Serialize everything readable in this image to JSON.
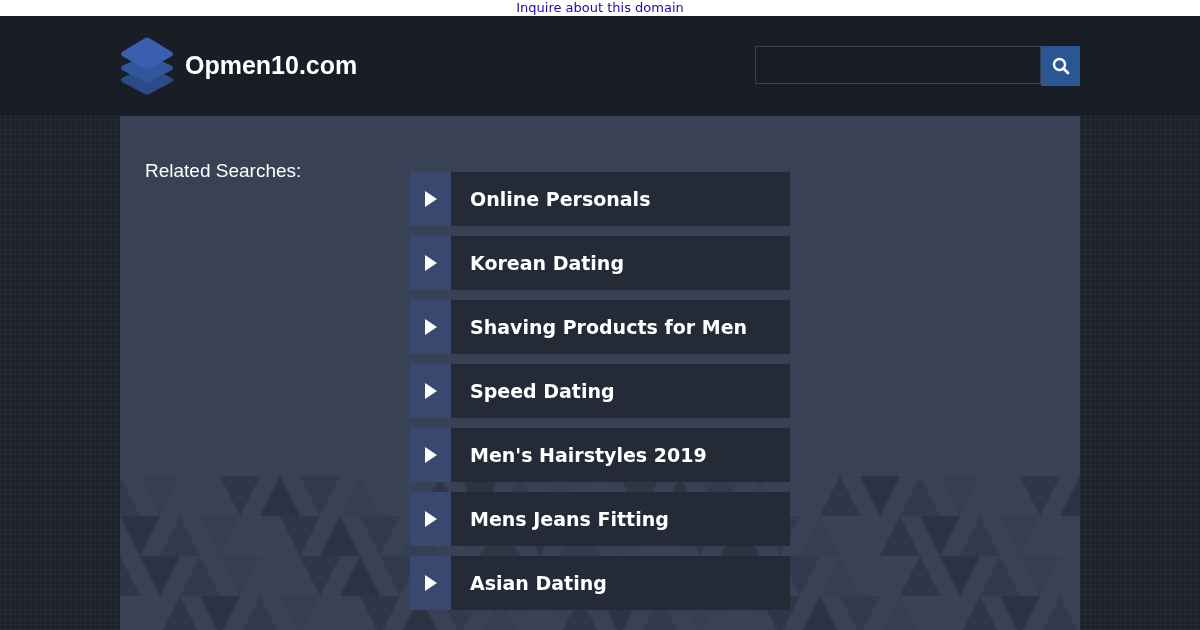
{
  "top_bar": {
    "link": "Inquire about this domain"
  },
  "header": {
    "site_name": "Opmen10.com"
  },
  "related_searches": {
    "heading": "Related Searches:",
    "items": [
      {
        "label": "Online Personals"
      },
      {
        "label": "Korean Dating"
      },
      {
        "label": "Shaving Products for Men"
      },
      {
        "label": "Speed Dating"
      },
      {
        "label": "Men's Hairstyles 2019"
      },
      {
        "label": "Mens Jeans Fitting"
      },
      {
        "label": "Asian Dating"
      }
    ]
  }
}
